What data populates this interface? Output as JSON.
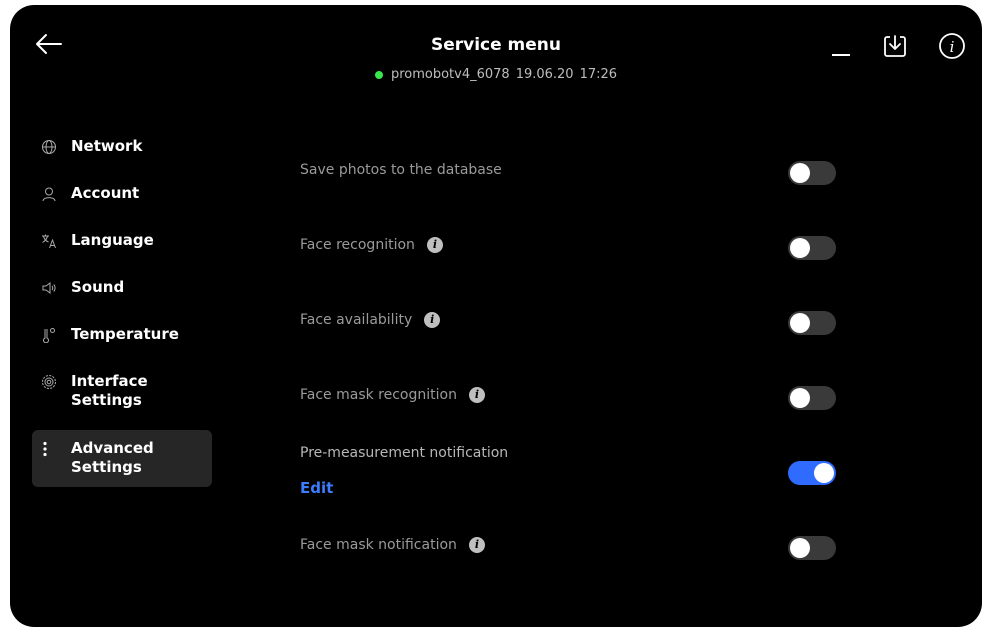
{
  "header": {
    "title": "Service menu",
    "status_online_color": "#39e54a",
    "device_id": "promobotv4_6078",
    "date": "19.06.20",
    "time": "17:26",
    "minimize_symbol": "_",
    "icons": [
      "back-arrow-icon",
      "minimize-icon",
      "download-icon",
      "info-icon"
    ]
  },
  "sidebar": {
    "items": [
      {
        "label": "Network",
        "icon": "globe-icon"
      },
      {
        "label": "Account",
        "icon": "user-icon"
      },
      {
        "label": "Language",
        "icon": "translate-icon"
      },
      {
        "label": "Sound",
        "icon": "speaker-icon"
      },
      {
        "label": "Temperature",
        "icon": "thermometer-icon"
      },
      {
        "label": "Interface\nSettings",
        "icon": "gear-icon"
      },
      {
        "label": "Advanced\nSettings",
        "icon": "more-vertical-icon",
        "active": true
      }
    ]
  },
  "settings": {
    "rows": [
      {
        "label": "Save photos to the database",
        "info": false,
        "enabled": false
      },
      {
        "label": "Face recognition",
        "info": true,
        "enabled": false
      },
      {
        "label": "Face availability",
        "info": true,
        "enabled": false
      },
      {
        "label": "Face mask recognition",
        "info": true,
        "enabled": false
      },
      {
        "label": "Pre-measurement notification",
        "info": false,
        "enabled": true,
        "edit_label": "Edit"
      },
      {
        "label": "Face mask notification",
        "info": true,
        "enabled": false
      }
    ],
    "info_glyph": "i",
    "accent_color": "#2f6bff"
  }
}
